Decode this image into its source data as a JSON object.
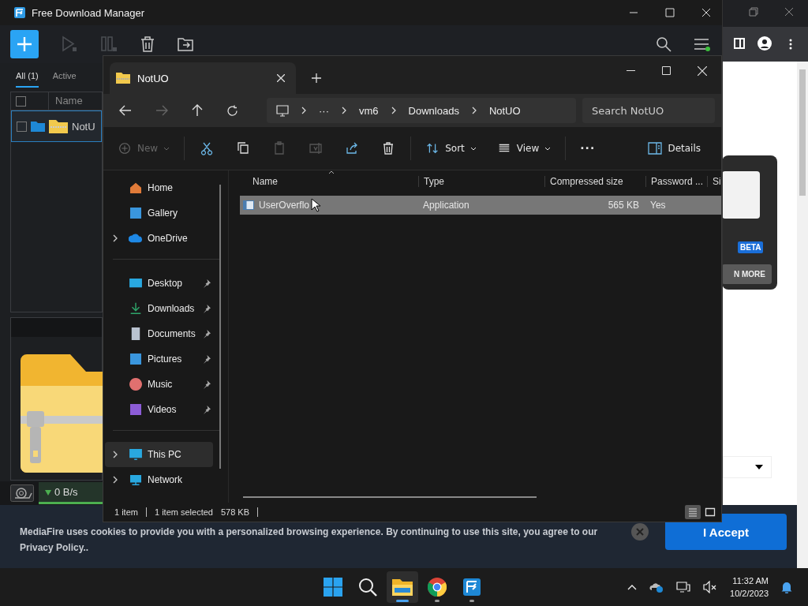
{
  "browser": {
    "promo": {
      "badge": "BETA",
      "button": "N MORE"
    }
  },
  "download_manager": {
    "title": "Free Download Manager",
    "select_all": {
      "checked": false
    },
    "tabs": [
      {
        "label": "All (1)",
        "selected": true
      },
      {
        "label": "Active",
        "selected": false
      }
    ],
    "columns": [
      "Name"
    ],
    "rows": [
      {
        "name": "NotU",
        "checked": false,
        "selected": true
      }
    ],
    "speed": "0 B/s"
  },
  "cookie_banner": {
    "text": "MediaFire uses cookies to provide you with a personalized browsing experience. By continuing to use this site, you agree to our Privacy Policy..",
    "accept": "I Accept"
  },
  "explorer": {
    "tab": "NotUO",
    "breadcrumb": [
      "···",
      "vm6",
      "Downloads",
      "NotUO"
    ],
    "search": {
      "placeholder": "Search NotUO"
    },
    "toolbar": [
      {
        "kind": "new",
        "label": "New",
        "disabled": true
      },
      {
        "kind": "cut",
        "disabled": false
      },
      {
        "kind": "copy",
        "disabled": false
      },
      {
        "kind": "paste",
        "disabled": true
      },
      {
        "kind": "rename",
        "disabled": true
      },
      {
        "kind": "share",
        "disabled": false
      },
      {
        "kind": "delete",
        "disabled": false
      },
      {
        "kind": "sort",
        "label": "Sort",
        "disabled": false
      },
      {
        "kind": "view",
        "label": "View",
        "disabled": false
      },
      {
        "kind": "more",
        "label": "···",
        "disabled": false
      }
    ],
    "details": "Details",
    "sidebar": [
      [
        {
          "label": "Home",
          "kind": "home",
          "pinned": false,
          "expandable": false,
          "selected": false
        },
        {
          "label": "Gallery",
          "kind": "gallery",
          "pinned": false,
          "expandable": false,
          "selected": false
        },
        {
          "label": "OneDrive",
          "kind": "cloud",
          "pinned": false,
          "expandable": true,
          "selected": false
        }
      ],
      [
        {
          "label": "Desktop",
          "kind": "desktop",
          "pinned": true,
          "expandable": false,
          "selected": false
        },
        {
          "label": "Downloads",
          "kind": "download",
          "pinned": true,
          "expandable": false,
          "selected": false
        },
        {
          "label": "Documents",
          "kind": "document",
          "pinned": true,
          "expandable": false,
          "selected": false
        },
        {
          "label": "Pictures",
          "kind": "gallery",
          "pinned": true,
          "expandable": false,
          "selected": false
        },
        {
          "label": "Music",
          "kind": "music",
          "pinned": true,
          "expandable": false,
          "selected": false
        },
        {
          "label": "Videos",
          "kind": "video",
          "pinned": true,
          "expandable": false,
          "selected": false
        }
      ],
      [
        {
          "label": "This PC",
          "kind": "pc",
          "pinned": false,
          "expandable": true,
          "selected": true
        },
        {
          "label": "Network",
          "kind": "network",
          "pinned": false,
          "expandable": true,
          "selected": false
        }
      ]
    ],
    "columns": [
      "Name",
      "Type",
      "Compressed size",
      "Password ...",
      "Si"
    ],
    "rows": [
      {
        "name": "UserOverflo",
        "type": "Application",
        "compressed_size": "565 KB",
        "password": "Yes",
        "selected": true
      }
    ],
    "status": {
      "count": "1 item",
      "selection": "1 item selected",
      "size": "578 KB"
    },
    "views": [
      {
        "kind": "details",
        "selected": true
      },
      {
        "kind": "tiles",
        "selected": false
      }
    ]
  },
  "taskbar": {
    "apps": [
      {
        "kind": "start",
        "selected": false,
        "running": false
      },
      {
        "kind": "search",
        "selected": false,
        "running": false
      },
      {
        "kind": "explorer",
        "selected": true,
        "running": true
      },
      {
        "kind": "chrome",
        "selected": false,
        "running": true
      },
      {
        "kind": "fdm",
        "selected": false,
        "running": true
      }
    ],
    "time": "11:32 AM",
    "date": "10/2/2023"
  }
}
